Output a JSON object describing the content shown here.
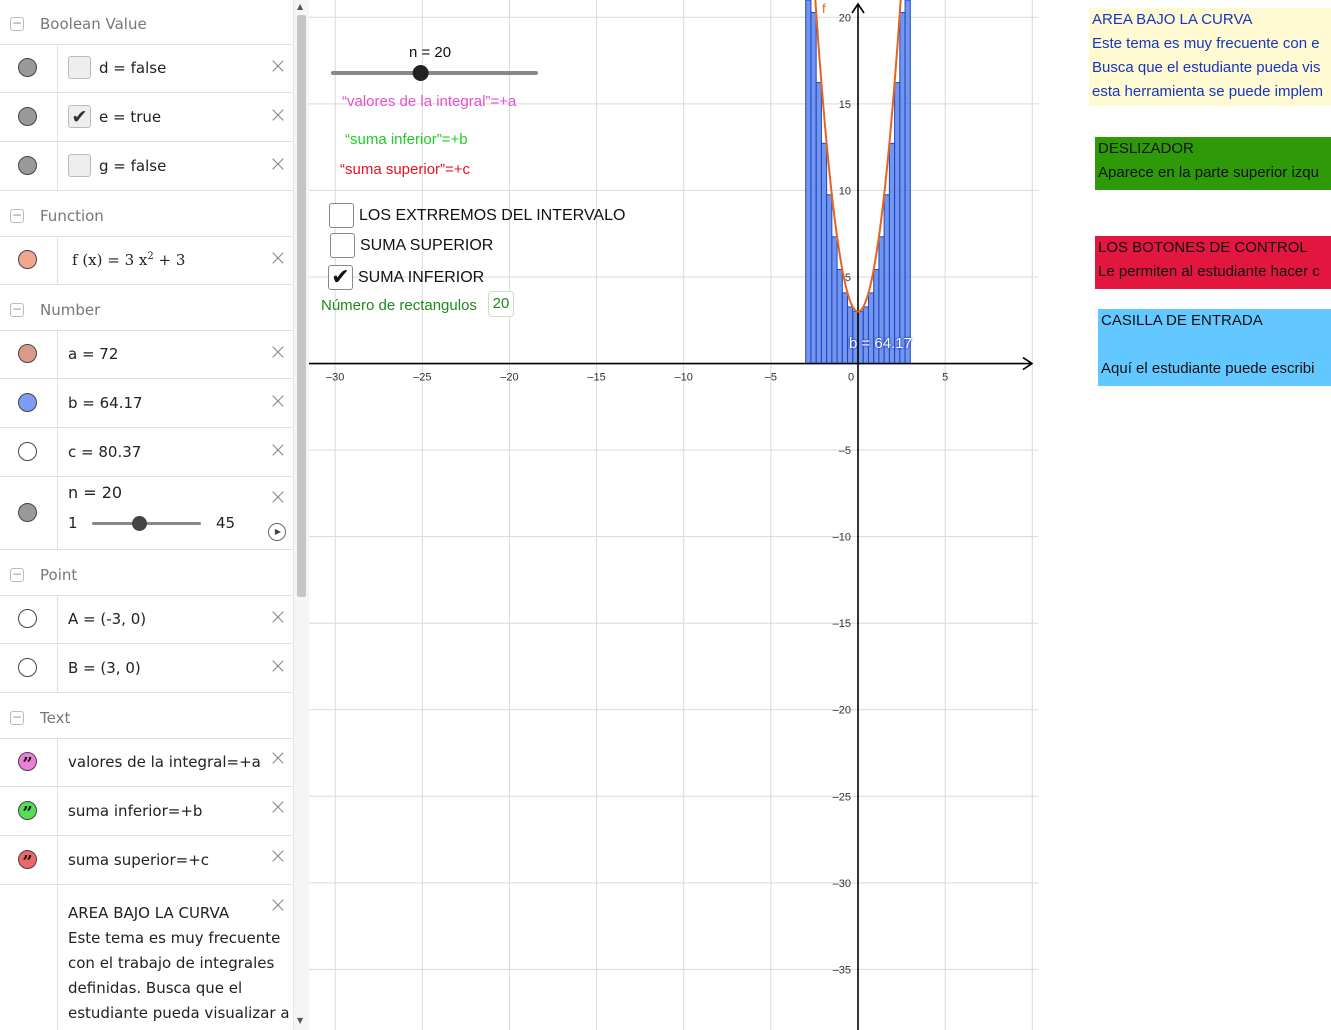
{
  "algebra": {
    "categories": {
      "boolean": "Boolean Value",
      "function": "Function",
      "number": "Number",
      "point": "Point",
      "text": "Text"
    },
    "booleans": [
      {
        "text": "d  =  false",
        "checked": false
      },
      {
        "text": "e  =  true",
        "checked": true
      },
      {
        "text": "g  =  false",
        "checked": false
      }
    ],
    "function": {
      "prefix": "f (x)  =  3 x",
      "exponent": "2",
      "suffix": " + 3"
    },
    "numbers": [
      {
        "text": "a  =  72",
        "color": "#d99a8a"
      },
      {
        "text": "b  =  64.17",
        "color": "#7d9bf0"
      },
      {
        "text": "c  =  80.37",
        "color": "#ffffff"
      }
    ],
    "slider": {
      "label": "n = 20",
      "min": "1",
      "max": "45",
      "value": 20
    },
    "points": [
      {
        "text": "A  =  (-3, 0)"
      },
      {
        "text": "B  =  (3, 0)"
      }
    ],
    "texts": [
      {
        "text": "valores de la integral=+a",
        "color": "#ec7fd6"
      },
      {
        "text": "suma inferior=+b",
        "color": "#55dd55"
      },
      {
        "text": "suma superior=+c",
        "color": "#ee6666"
      }
    ],
    "long_text": {
      "title": "AREA BAJO LA CURVA",
      "lines": [
        "Este tema es muy frecuente",
        "con el trabajo de integrales",
        "definidas. Busca que el",
        "estudiante pueda visualizar a"
      ]
    }
  },
  "graphics": {
    "slider_label": "n = 20",
    "slider_value": 20,
    "slider_min": 1,
    "slider_max": 45,
    "text_integral": "“valores de la integral”=+a",
    "text_inferior": "“suma inferior”=+b",
    "text_superior": "“suma superior”=+c",
    "checkboxes": [
      {
        "label": "LOS EXTRREMOS DEL INTERVALO",
        "checked": false
      },
      {
        "label": "SUMA SUPERIOR",
        "checked": false
      },
      {
        "label": "SUMA INFERIOR",
        "checked": true
      }
    ],
    "input_label": "Número de rectangulos",
    "input_value": "20",
    "function_label": "f",
    "rect_label": "b = 64.17",
    "x_ticks": [
      "–30",
      "–25",
      "–20",
      "–15",
      "–10",
      "–5",
      "0",
      "5"
    ],
    "y_ticks": [
      "20",
      "15",
      "10",
      "5",
      "–5",
      "–10",
      "–15",
      "–20",
      "–25",
      "–30",
      "–35"
    ],
    "colors": {
      "function": "#e8641a",
      "rects": "#1a46c8",
      "rect_fill": "#5a82e8",
      "integral_text": "#e84fd0",
      "inferior_text": "#22cc22",
      "superior_text": "#e8111b",
      "input_label": "#1d8a1d"
    }
  },
  "chart_data": {
    "type": "area",
    "function": "f(x) = 3x^2 + 3",
    "interval": [
      -3,
      3
    ],
    "n": 20,
    "lower_sum": 64.17,
    "upper_sum": 80.37,
    "integral": 72,
    "x_range": [
      -31.5,
      10.5
    ],
    "y_range": [
      -38.5,
      21
    ]
  },
  "right_panel": [
    {
      "title": "AREA BAJO LA CURVA",
      "lines": [
        "Este tema es muy frecuente con e",
        "Busca que el estudiante pueda vis",
        "esta herramienta se puede implem"
      ],
      "bg": "#fffad1",
      "color": "#1536c4"
    },
    {
      "title": "DESLIZADOR",
      "lines": [
        "Aparece en la parte superior izqu"
      ],
      "bg": "#2f9a07",
      "color": "#111111"
    },
    {
      "title": "LOS BOTONES DE CONTROL",
      "lines": [
        "Le permiten al estudiante hacer c"
      ],
      "bg": "#e2163e",
      "color": "#111111"
    },
    {
      "title": "CASILLA DE ENTRADA",
      "lines": [
        "",
        "Aquí el estudiante puede escribi"
      ],
      "bg": "#63c8ff",
      "color": "#111111"
    }
  ]
}
